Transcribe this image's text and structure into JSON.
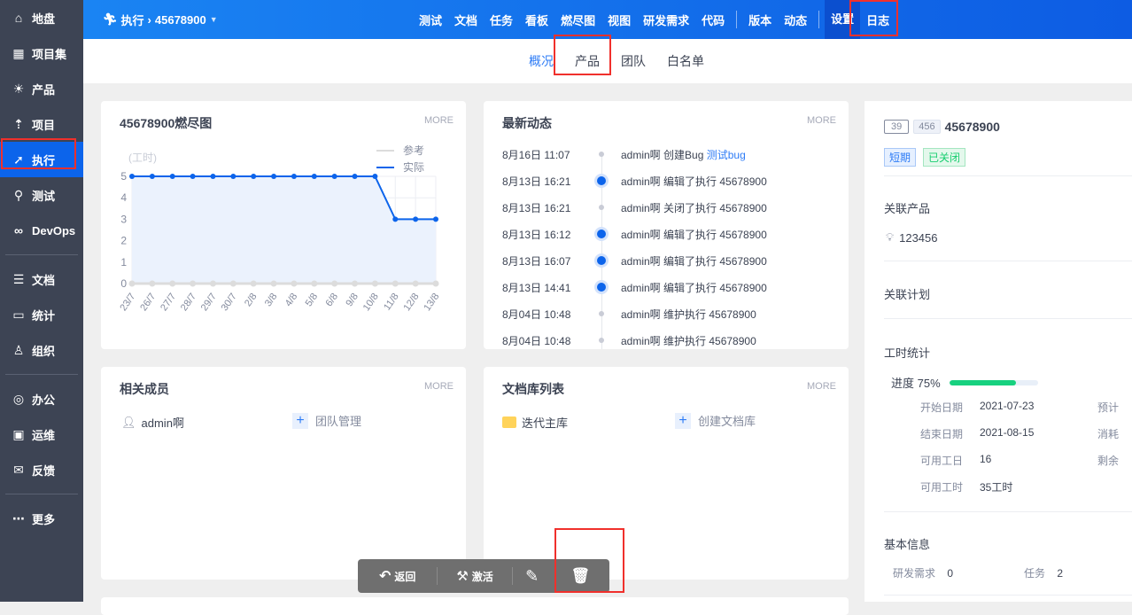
{
  "sidebar": {
    "items": [
      {
        "label": "地盘",
        "icon": "home-icon"
      },
      {
        "label": "项目集",
        "icon": "grid-icon"
      },
      {
        "label": "产品",
        "icon": "bulb-icon"
      },
      {
        "label": "项目",
        "icon": "rocket-icon"
      },
      {
        "label": "执行",
        "icon": "run-icon",
        "active": true
      },
      {
        "label": "测试",
        "icon": "search-icon"
      },
      {
        "label": "DevOps",
        "icon": "infinity-icon"
      },
      {
        "label": "文档",
        "icon": "doc-icon"
      },
      {
        "label": "统计",
        "icon": "chart-icon"
      },
      {
        "label": "组织",
        "icon": "user-icon"
      },
      {
        "label": "办公",
        "icon": "oa-icon"
      },
      {
        "label": "运维",
        "icon": "ops-icon"
      },
      {
        "label": "反馈",
        "icon": "feedback-icon"
      },
      {
        "label": "更多",
        "icon": "more-icon"
      }
    ]
  },
  "topbar": {
    "section": "执行",
    "execution": "45678900",
    "nav": [
      "测试",
      "文档",
      "任务",
      "看板",
      "燃尽图",
      "视图",
      "研发需求",
      "代码"
    ],
    "nav2": [
      "版本",
      "动态"
    ],
    "nav3": [
      "设置",
      "日志"
    ]
  },
  "subnav": [
    "概况",
    "产品",
    "团队",
    "白名单"
  ],
  "burndown": {
    "title": "45678900燃尽图",
    "more": "MORE"
  },
  "chart_data": {
    "type": "line",
    "title": "45678900燃尽图",
    "ylabel": "(工时)",
    "ylim": [
      0,
      5
    ],
    "yticks": [
      0,
      1,
      2,
      3,
      4,
      5
    ],
    "categories": [
      "23/7",
      "26/7",
      "27/7",
      "28/7",
      "29/7",
      "30/7",
      "2/8",
      "3/8",
      "4/8",
      "5/8",
      "6/8",
      "9/8",
      "10/8",
      "11/8",
      "12/8",
      "13/8"
    ],
    "series": [
      {
        "name": "参考",
        "color": "#dcdcdc",
        "values": [
          0,
          0,
          0,
          0,
          0,
          0,
          0,
          0,
          0,
          0,
          0,
          0,
          0,
          0,
          0,
          0
        ]
      },
      {
        "name": "实际",
        "color": "#0c64eb",
        "values": [
          5,
          5,
          5,
          5,
          5,
          5,
          5,
          5,
          5,
          5,
          5,
          5,
          5,
          3,
          3,
          3
        ]
      }
    ],
    "legend": "top-right"
  },
  "activity": {
    "title": "最新动态",
    "more": "MORE",
    "items": [
      {
        "time": "8月16日 11:07",
        "text": "admin啊 创建Bug ",
        "link": "测试bug",
        "hl": false
      },
      {
        "time": "8月13日 16:21",
        "text": "admin啊 编辑了执行 45678900",
        "hl": true
      },
      {
        "time": "8月13日 16:21",
        "text": "admin啊 关闭了执行 45678900",
        "hl": false
      },
      {
        "time": "8月13日 16:12",
        "text": "admin啊 编辑了执行 45678900",
        "hl": true
      },
      {
        "time": "8月13日 16:07",
        "text": "admin啊 编辑了执行 45678900",
        "hl": true
      },
      {
        "time": "8月13日 14:41",
        "text": "admin啊 编辑了执行 45678900",
        "hl": true
      },
      {
        "time": "8月04日 10:48",
        "text": "admin啊 维护执行 45678900",
        "hl": false
      },
      {
        "time": "8月04日 10:48",
        "text": "admin啊 维护执行 45678900",
        "hl": false
      }
    ]
  },
  "members": {
    "title": "相关成员",
    "more": "MORE",
    "user": "admin啊",
    "manage": "团队管理"
  },
  "doclib": {
    "title": "文档库列表",
    "more": "MORE",
    "lib": "迭代主库",
    "create": "创建文档库"
  },
  "summary": {
    "id": "39",
    "code": "456",
    "name": "45678900",
    "tag_type": "短期",
    "tag_status": "已关闭",
    "product_title": "关联产品",
    "product": "123456",
    "plan_title": "关联计划",
    "hours_title": "工时统计",
    "progress_label": "进度 75%",
    "progress": 0.75,
    "rows": [
      {
        "label": "开始日期",
        "value": "2021-07-23",
        "right": "预计"
      },
      {
        "label": "结束日期",
        "value": "2021-08-15",
        "right": "消耗"
      },
      {
        "label": "可用工日",
        "value": "16",
        "right": "剩余"
      },
      {
        "label": "可用工时",
        "value": "35工时",
        "right": ""
      }
    ],
    "basic_title": "基本信息",
    "stories_label": "研发需求",
    "stories": "0",
    "tasks_label": "任务",
    "tasks": "2"
  },
  "toolbar": {
    "back": "返回",
    "activate": "激活"
  }
}
